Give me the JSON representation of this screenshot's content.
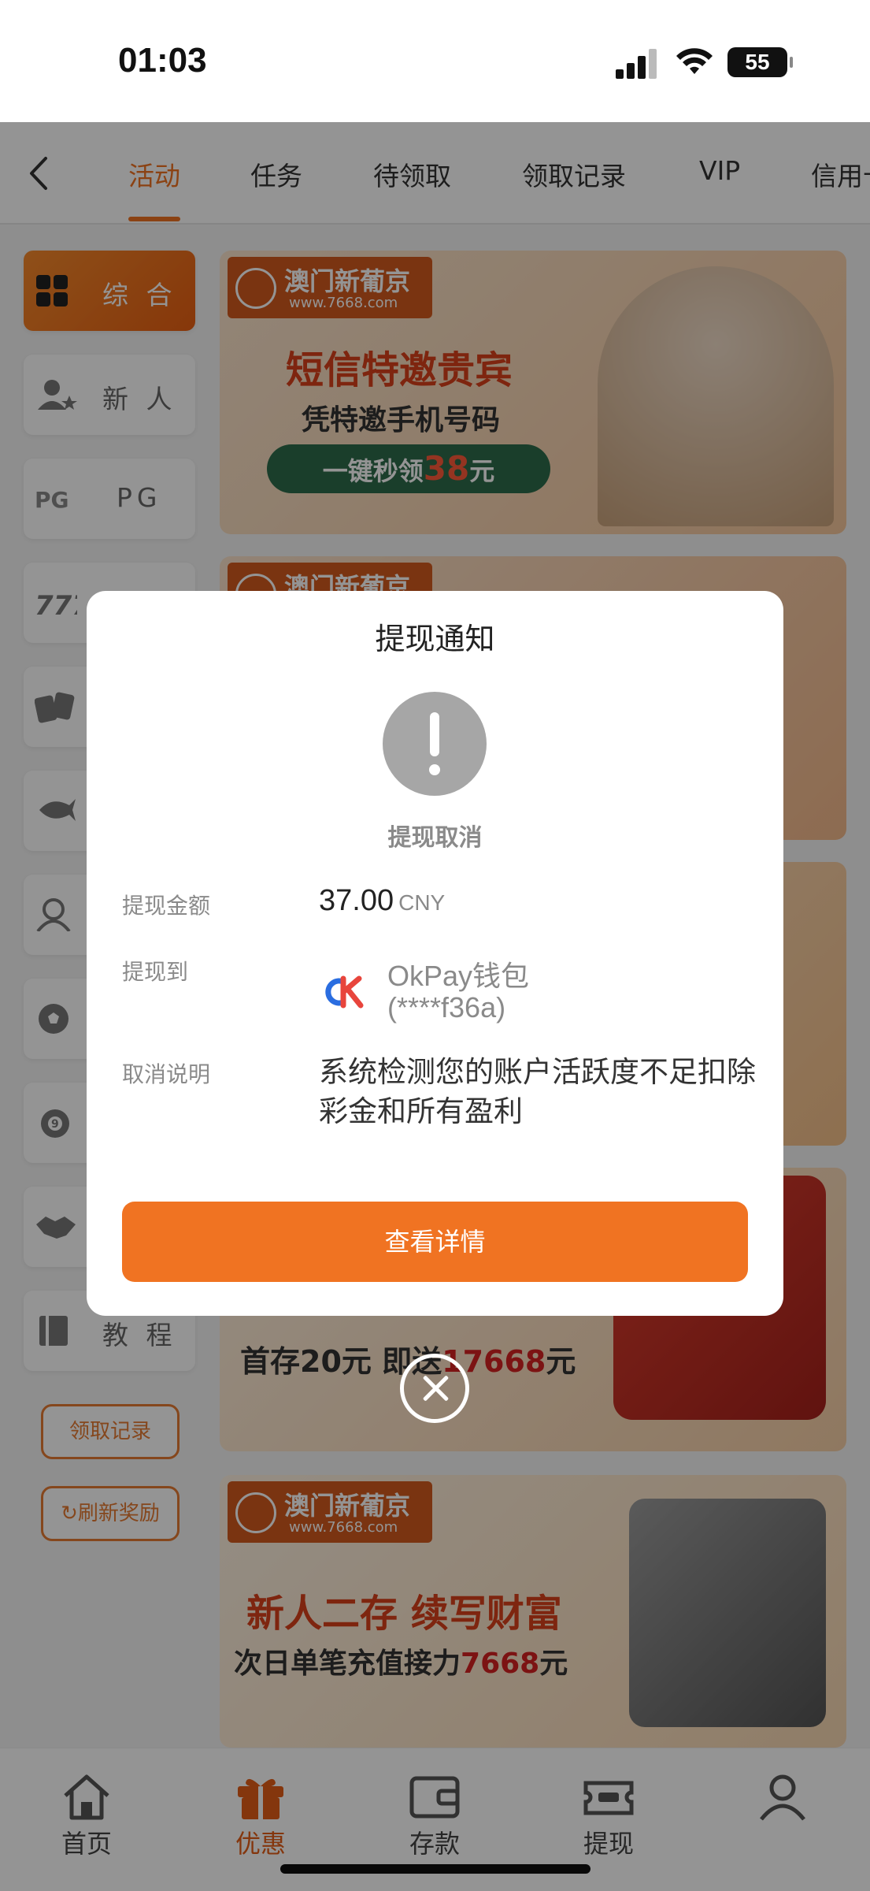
{
  "status_bar": {
    "time": "01:03",
    "battery": "55"
  },
  "nav": {
    "back_icon": "chevron-left-icon",
    "tabs": [
      {
        "label": "活动",
        "active": true
      },
      {
        "label": "任务",
        "active": false
      },
      {
        "label": "待领取",
        "active": false
      },
      {
        "label": "领取记录",
        "active": false
      },
      {
        "label": "VIP",
        "active": false
      },
      {
        "label": "信用卡",
        "active": false
      }
    ]
  },
  "sidebar": {
    "items": [
      {
        "label": "综 合",
        "icon": "grid-icon",
        "active": true
      },
      {
        "label": "新 人",
        "icon": "user-star-icon",
        "active": false
      },
      {
        "label": "PG",
        "icon": "pg-logo-icon",
        "active": false
      },
      {
        "label": "",
        "icon": "slot-777-icon",
        "active": false
      },
      {
        "label": "",
        "icon": "poker-cards-icon",
        "active": false
      },
      {
        "label": "",
        "icon": "fish-icon",
        "active": false
      },
      {
        "label": "",
        "icon": "dealer-icon",
        "active": false
      },
      {
        "label": "",
        "icon": "soccer-ball-icon",
        "active": false
      },
      {
        "label": "",
        "icon": "lottery-ball-icon",
        "active": false
      },
      {
        "label": "",
        "icon": "handshake-icon",
        "active": false
      },
      {
        "label": "教 程",
        "icon": "book-icon",
        "active": false
      }
    ],
    "claim_record": "领取记录",
    "refresh_reward": "刷新奖励"
  },
  "banners": [
    {
      "brand": "澳门新葡京",
      "url": "www.7668.com",
      "title": "短信特邀贵宾",
      "sub": "凭特邀手机号码",
      "cta_prefix": "一键秒领",
      "cta_amount": "38",
      "cta_suffix": "元"
    },
    {
      "brand": "澳门新葡京"
    },
    {
      "title_prefix": "首存20元 即送",
      "title_amount": "17668",
      "title_suffix": "元"
    },
    {
      "brand": "澳门新葡京",
      "url": "www.7668.com",
      "title": "新人二存 续写财富",
      "sub_prefix": "次日单笔充值接力",
      "sub_amount": "7668",
      "sub_suffix": "元"
    }
  ],
  "modal": {
    "title": "提现通知",
    "status_icon": "exclamation-circle-icon",
    "status_text": "提现取消",
    "amount_label": "提现金额",
    "amount_value": "37.00",
    "amount_currency": "CNY",
    "to_label": "提现到",
    "wallet_name": "OkPay钱包",
    "wallet_account": "(****f36a)",
    "reason_label": "取消说明",
    "reason_text": "系统检测您的账户活跃度不足扣除彩金和所有盈利",
    "button": "查看详情"
  },
  "tabbar": {
    "items": [
      {
        "label": "首页",
        "icon": "home-icon",
        "active": false
      },
      {
        "label": "优惠",
        "icon": "gift-icon",
        "active": true
      },
      {
        "label": "存款",
        "icon": "wallet-icon",
        "active": false
      },
      {
        "label": "提现",
        "icon": "ticket-icon",
        "active": false
      },
      {
        "label": "",
        "icon": "user-icon",
        "active": false
      }
    ]
  },
  "colors": {
    "accent": "#f07322",
    "overlay": "rgba(0,0,0,0.42)"
  }
}
